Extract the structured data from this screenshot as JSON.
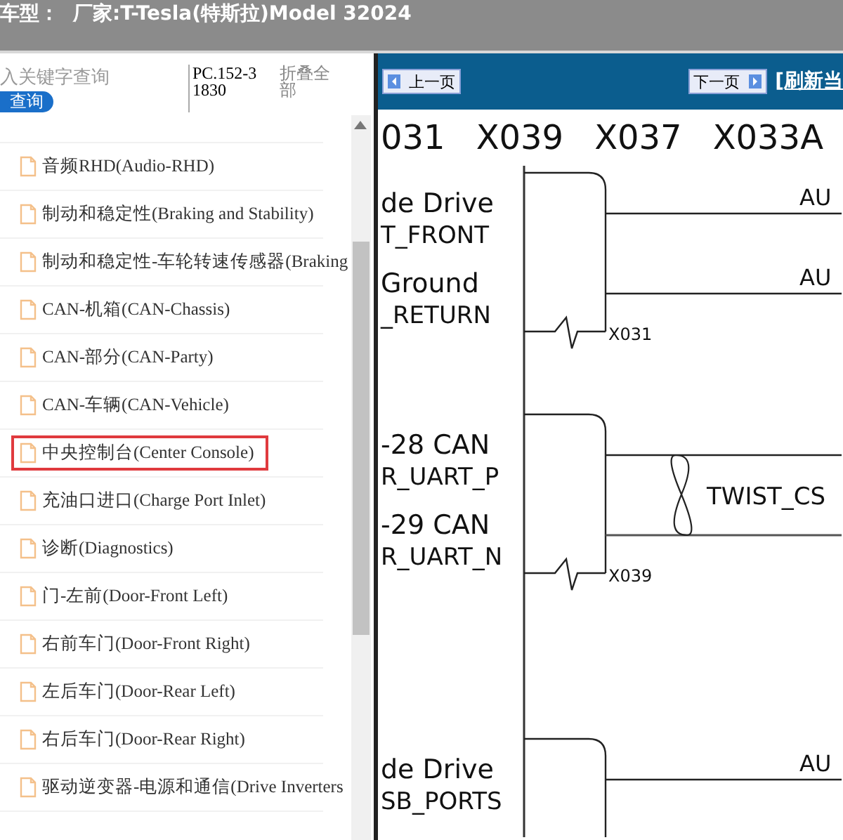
{
  "title_bar": {
    "label": "车型：",
    "value": "厂家:T-Tesla(特斯拉)Model 32024"
  },
  "sidebar": {
    "search": {
      "placeholder": "入关键字查询"
    },
    "search_button": "查询",
    "part_number": "PC.152-31830",
    "collapse_all": "折叠全部",
    "items": [
      {
        "label": "音频RHD(Audio-RHD)",
        "selected": false
      },
      {
        "label": "制动和稳定性(Braking and Stability)",
        "selected": false
      },
      {
        "label": "制动和稳定性-车轮转速传感器(Braking",
        "selected": false
      },
      {
        "label": "CAN-机箱(CAN-Chassis)",
        "selected": false
      },
      {
        "label": "CAN-部分(CAN-Party)",
        "selected": false
      },
      {
        "label": "CAN-车辆(CAN-Vehicle)",
        "selected": false
      },
      {
        "label": "中央控制台(Center Console)",
        "selected": true
      },
      {
        "label": "充油口进口(Charge Port Inlet)",
        "selected": false
      },
      {
        "label": "诊断(Diagnostics)",
        "selected": false
      },
      {
        "label": "门-左前(Door-Front Left)",
        "selected": false
      },
      {
        "label": "右前车门(Door-Front Right)",
        "selected": false
      },
      {
        "label": "左后车门(Door-Rear Left)",
        "selected": false
      },
      {
        "label": "右后车门(Door-Rear Right)",
        "selected": false
      },
      {
        "label": "驱动逆变器-电源和通信(Drive Inverters",
        "selected": false
      }
    ]
  },
  "toolbar": {
    "prev": "上一页",
    "next": "下一页",
    "refresh": "[刷新当"
  },
  "connectors": [
    "031",
    "X039",
    "X037",
    "X033A"
  ],
  "diagram": {
    "blocks": [
      {
        "pins": [
          "de Drive",
          "T_FRONT",
          "Ground",
          "_RETURN"
        ],
        "wires": [
          "AU",
          "AU"
        ],
        "connector": "X031"
      },
      {
        "pins": [
          "-28 CAN",
          "R_UART_P",
          "-29 CAN",
          "R_UART_N"
        ],
        "connector": "X039",
        "twist_label": "TWIST_CS"
      },
      {
        "pins": [
          "de Drive",
          "SB_PORTS"
        ],
        "wires": [
          "AU"
        ]
      }
    ]
  }
}
